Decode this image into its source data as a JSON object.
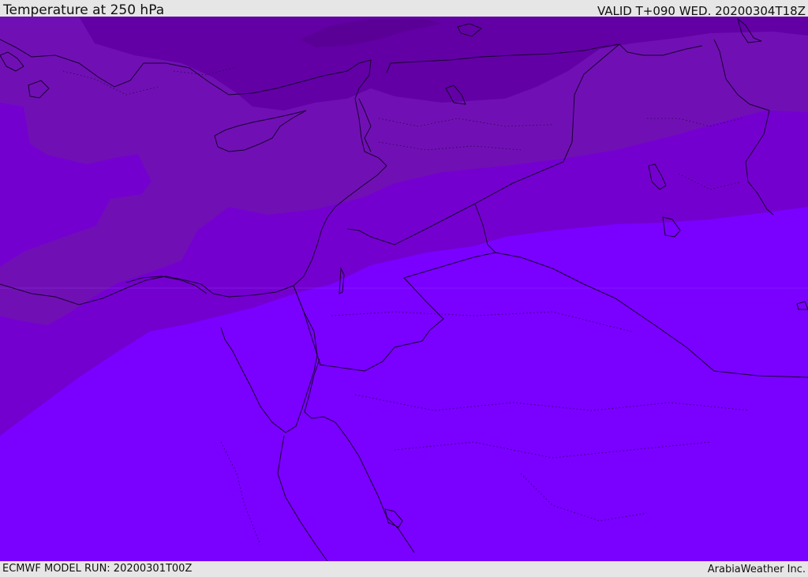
{
  "header": {
    "title": "Temperature at 250 hPa",
    "valid": "VALID T+090 WED. 20200304T18Z"
  },
  "footer": {
    "model_run": "ECMWF MODEL RUN: 20200301T00Z",
    "credit": "ArabiaWeather Inc."
  },
  "map": {
    "colors": {
      "coldest": "#5a0096",
      "cold": "#6200a6",
      "cool": "#7010b4",
      "mild": "#7400d0",
      "warm": "#7a00ff",
      "border": "#1a0030"
    }
  }
}
